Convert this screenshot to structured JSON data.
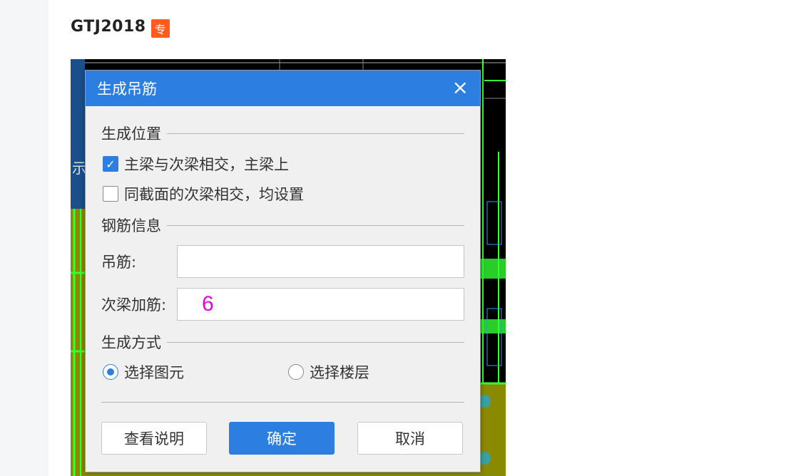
{
  "post": {
    "title": "GTJ2018",
    "badge": "专"
  },
  "background_fragment": {
    "text": "示"
  },
  "dialog": {
    "title": "生成吊筋",
    "close_glyph": "×",
    "section_position": "生成位置",
    "checkbox_main_beam": {
      "label": "主梁与次梁相交，主梁上",
      "checked": true
    },
    "checkbox_same_section": {
      "label": "同截面的次梁相交，均设置",
      "checked": false
    },
    "section_rebar": "钢筋信息",
    "field_hanger": {
      "label": "吊筋:",
      "value": ""
    },
    "field_secondary": {
      "label": "次梁加筋:",
      "value": "6"
    },
    "section_method": "生成方式",
    "radio_select_element": {
      "label": "选择图元",
      "selected": true
    },
    "radio_select_floor": {
      "label": "选择楼层",
      "selected": false
    },
    "buttons": {
      "help": "查看说明",
      "ok": "确定",
      "cancel": "取消"
    }
  },
  "colors": {
    "accent": "#2c7fe0",
    "badge": "#ff5a1f",
    "input_text": "#e600e6",
    "cad_green": "#33ff33",
    "cad_yellow": "#c8c800"
  }
}
